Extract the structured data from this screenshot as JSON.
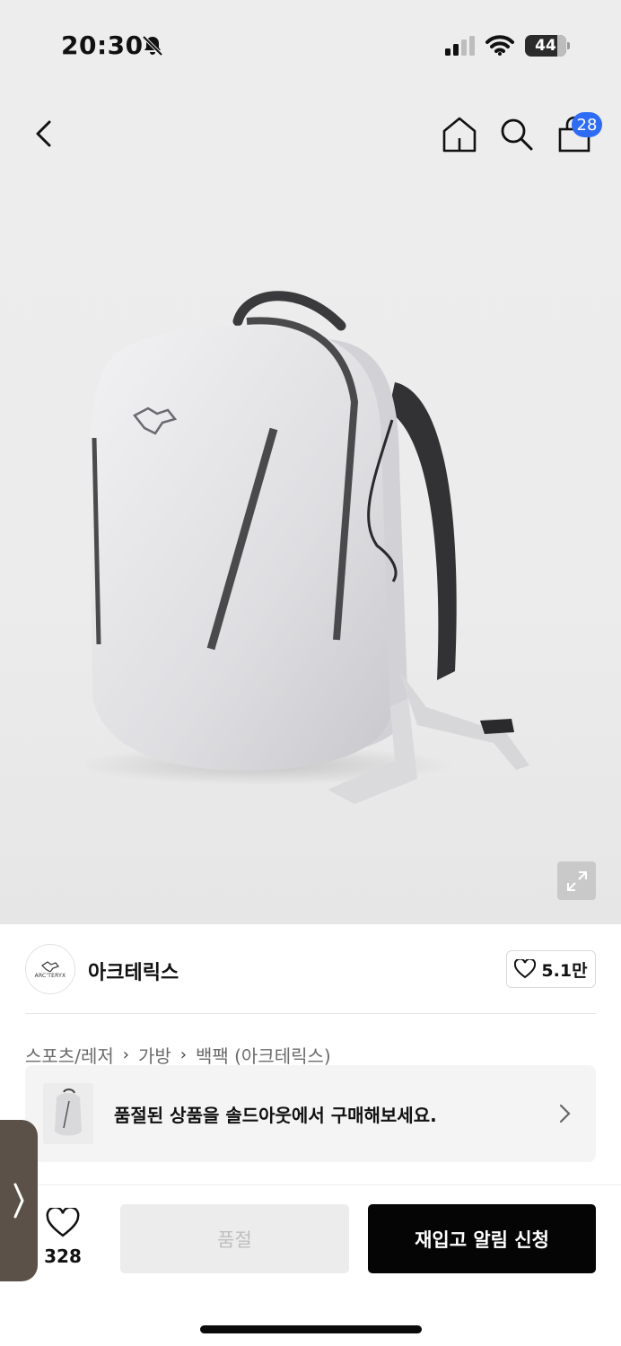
{
  "status_bar": {
    "time": "20:30",
    "battery": "44",
    "icons": [
      "bell-off-icon",
      "signal-icon",
      "wifi-icon",
      "battery-icon"
    ]
  },
  "header": {
    "icons": [
      "back-icon",
      "home-icon",
      "search-icon",
      "cart-icon"
    ],
    "cart_count": "28"
  },
  "hero": {
    "image": "grey-backpack-photo",
    "zoom_icon": "expand-icon"
  },
  "brand": {
    "logo_text": "ARC'TERYX",
    "name": "아크테릭스",
    "likes": "5.1만"
  },
  "breadcrumb": {
    "items": [
      "스포츠/레저",
      "가방",
      "백팩 (아크테릭스)"
    ],
    "separator": "›"
  },
  "soldout_banner": {
    "text": "품절된 상품을 솔드아웃에서 구매해보세요."
  },
  "bottom_bar": {
    "wish_count": "328",
    "soldout_label": "품절",
    "restock_label": "재입고 알림 신청"
  },
  "colors": {
    "accent_badge": "#2f6cf5",
    "primary_button": "#050505",
    "disabled_button": "#ececec",
    "side_handle": "#5b5149"
  }
}
